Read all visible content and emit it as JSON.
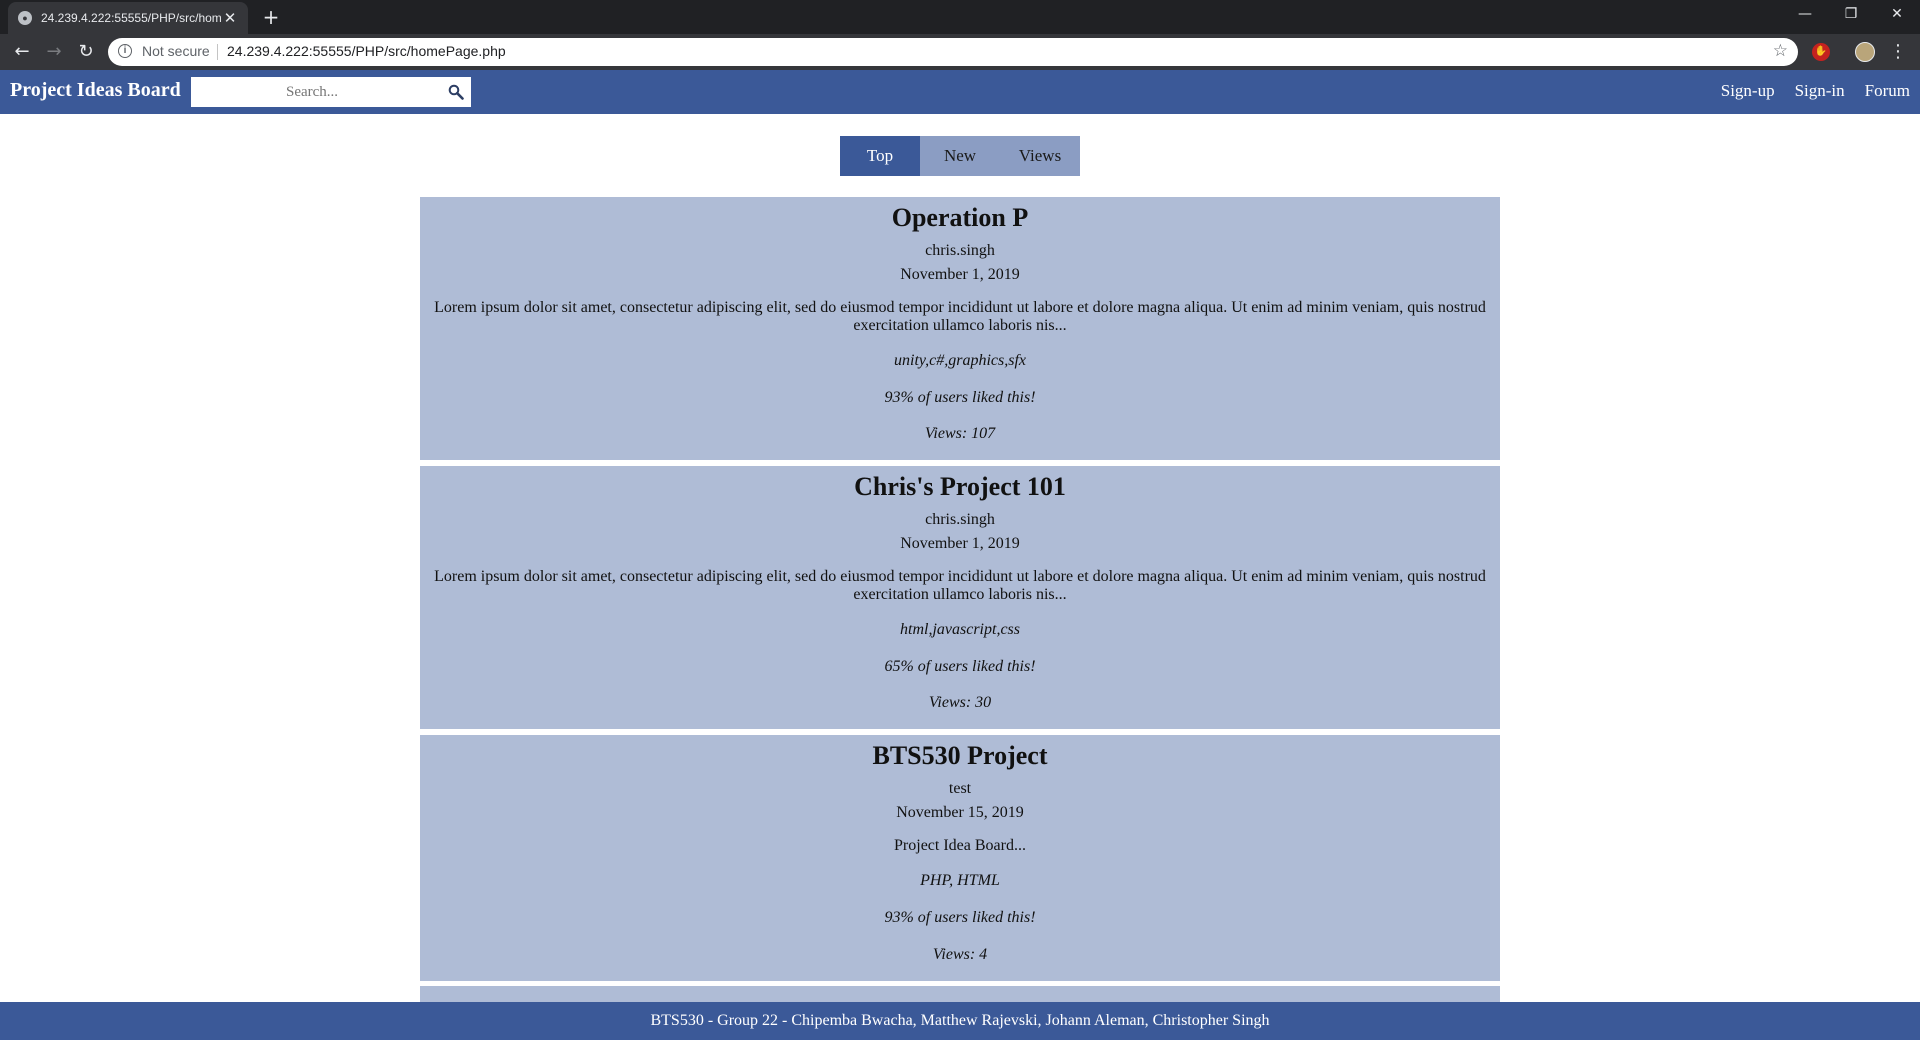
{
  "browser": {
    "tab_title": "24.239.4.222:55555/PHP/src/homePage.php",
    "security_label": "Not secure",
    "url": "24.239.4.222:55555/PHP/src/homePage.php",
    "new_tab_glyph": "+",
    "window_controls": {
      "minimize": "—",
      "restore": "❐",
      "close": "✕"
    }
  },
  "header": {
    "brand": "Project Ideas Board",
    "search_placeholder": "Search...",
    "nav": {
      "signup": "Sign-up",
      "signin": "Sign-in",
      "forum": "Forum"
    }
  },
  "sort_tabs": [
    {
      "label": "Top",
      "active": true
    },
    {
      "label": "New",
      "active": false
    },
    {
      "label": "Views",
      "active": false
    }
  ],
  "posts": [
    {
      "title": "Operation P",
      "author": "chris.singh",
      "date": "November 1, 2019",
      "description": "Lorem ipsum dolor sit amet, consectetur adipiscing elit, sed do eiusmod tempor incididunt ut labore et dolore magna aliqua. Ut enim ad minim veniam, quis nostrud exercitation ullamco laboris nis...",
      "tags": "unity,c#,graphics,sfx",
      "likes": "93% of users liked this!",
      "views": "Views: 107"
    },
    {
      "title": "Chris's Project 101",
      "author": "chris.singh",
      "date": "November 1, 2019",
      "description": "Lorem ipsum dolor sit amet, consectetur adipiscing elit, sed do eiusmod tempor incididunt ut labore et dolore magna aliqua. Ut enim ad minim veniam, quis nostrud exercitation ullamco laboris nis...",
      "tags": "html,javascript,css",
      "likes": "65% of users liked this!",
      "views": "Views: 30"
    },
    {
      "title": "BTS530 Project",
      "author": "test",
      "date": "November 15, 2019",
      "description": "Project Idea Board...",
      "tags": "PHP, HTML",
      "likes": "93% of users liked this!",
      "views": "Views: 4"
    }
  ],
  "footer": {
    "text": "BTS530 - Group 22 - Chipemba Bwacha, Matthew Rajevski, Johann Aleman, Christopher Singh"
  },
  "colors": {
    "brand": "#3b5998",
    "tab_inactive": "#8b9dc3",
    "card_bg": "#afbcd6"
  }
}
